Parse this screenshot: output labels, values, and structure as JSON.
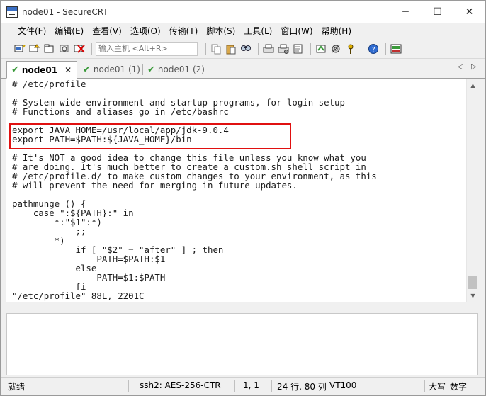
{
  "window": {
    "title": "node01 - SecureCRT"
  },
  "window_controls": {
    "minimize": "─",
    "maximize": "☐",
    "close": "✕"
  },
  "menu": [
    {
      "label": "文件(F)"
    },
    {
      "label": "编辑(E)"
    },
    {
      "label": "查看(V)"
    },
    {
      "label": "选项(O)"
    },
    {
      "label": "传输(T)"
    },
    {
      "label": "脚本(S)"
    },
    {
      "label": "工具(L)"
    },
    {
      "label": "窗口(W)"
    },
    {
      "label": "帮助(H)"
    }
  ],
  "toolbar": {
    "host_input_placeholder": "输入主机 <Alt+R>",
    "icons": [
      "connect-icon",
      "quick-connect-icon",
      "connect-tab-icon",
      "reconnect-icon",
      "disconnect-icon",
      "copy-icon",
      "paste-icon",
      "find-icon",
      "print-icon",
      "print-setup-icon",
      "log-icon",
      "session-options-icon",
      "global-options-icon",
      "keymap-icon",
      "help-icon",
      "sftp-icon"
    ]
  },
  "tabs": [
    {
      "label": "node01",
      "close": "✕",
      "active": true
    },
    {
      "label": "node01 (1)",
      "active": false
    },
    {
      "label": "node01 (2)",
      "active": false
    }
  ],
  "tab_nav": {
    "prev": "◁",
    "next": "▷"
  },
  "terminal": {
    "lines": [
      "# /etc/profile",
      "",
      "# System wide environment and startup programs, for login setup",
      "# Functions and aliases go in /etc/bashrc",
      "",
      "export JAVA_HOME=/usr/local/app/jdk-9.0.4",
      "export PATH=$PATH:${JAVA_HOME}/bin",
      "",
      "# It's NOT a good idea to change this file unless you know what you",
      "# are doing. It's much better to create a custom.sh shell script in",
      "# /etc/profile.d/ to make custom changes to your environment, as this",
      "# will prevent the need for merging in future updates.",
      "",
      "pathmunge () {",
      "    case \":${PATH}:\" in",
      "        *:\"$1\":*)",
      "            ;;",
      "        *)",
      "            if [ \"$2\" = \"after\" ] ; then",
      "                PATH=$PATH:$1",
      "            else",
      "                PATH=$1:$PATH",
      "            fi",
      "\"/etc/profile\" 88L, 2201C"
    ]
  },
  "status": {
    "ready": "就绪",
    "cipher": "ssh2: AES-256-CTR",
    "cursor_pos": "1,   1",
    "size": "24 行, 80 列",
    "terminal_type": "VT100",
    "caps": "大写",
    "num": "数字"
  },
  "colors": {
    "highlight_border": "#e01010",
    "active_tab_check": "#3a9a3a"
  }
}
